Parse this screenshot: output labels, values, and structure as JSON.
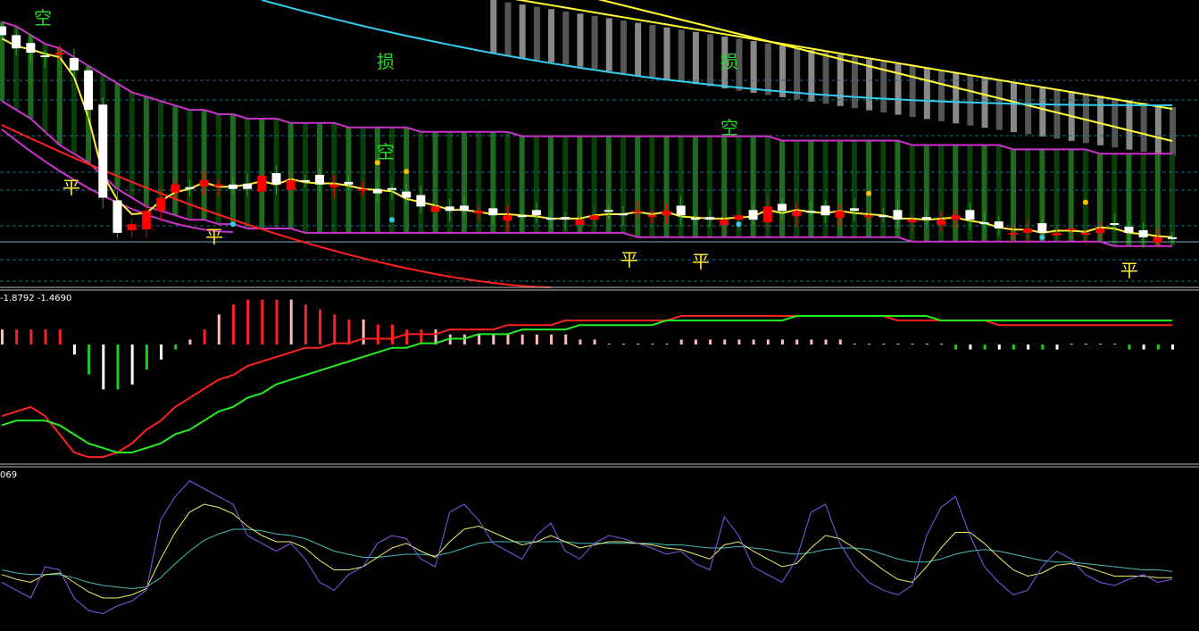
{
  "colors": {
    "background": "#000000",
    "bull": "#ff0000",
    "bear": "#ffffff",
    "band": "#cc33cc",
    "band_fill": "#1e6b1e",
    "upper_band": "#ffff33",
    "upper_fill": "#8a8a8a",
    "cyan_ma": "#33ccee",
    "red_ma": "#ff2020",
    "yellow_ma": "#ffee33",
    "white_seg": "#eeeeee",
    "green_label": "#22dd22",
    "yellow_label": "#ffee33",
    "macd_pos": "#ff2020",
    "macd_pos_light": "#ffbbbb",
    "macd_neg": "#22cc22",
    "macd_neg_light": "#ffffff",
    "diff_line": "#ff2020",
    "dea_line": "#22ee22",
    "osc_purple": "#8855ee",
    "osc_yellow": "#eeee66",
    "osc_cyan": "#44bbbb"
  },
  "panel2": {
    "values_label": "-1.8792  -1.4690"
  },
  "panel3": {
    "values_label": "069"
  },
  "signals": {
    "kong": "空",
    "ping": "平",
    "sun": "损"
  },
  "chart_data": [
    {
      "type": "candlestick",
      "panel": "main",
      "bars": 82,
      "closes": [
        97,
        94,
        93,
        92,
        93,
        89,
        80,
        60,
        52,
        54,
        57,
        60,
        63,
        62,
        64,
        63,
        62,
        62,
        65,
        63,
        64,
        64,
        63,
        63,
        63,
        62,
        61,
        62,
        60,
        58,
        58,
        57,
        57,
        57,
        56,
        56,
        56,
        56,
        55,
        55,
        55,
        56,
        57,
        56,
        57,
        56,
        57,
        56,
        55,
        55,
        55,
        56,
        55,
        58,
        57,
        57,
        57,
        56,
        57,
        57,
        56,
        56,
        55,
        55,
        55,
        55,
        56,
        55,
        54,
        53,
        52,
        53,
        52,
        52,
        53,
        52,
        53,
        54,
        52,
        51,
        51,
        51
      ],
      "series": [
        {
          "name": "upper band",
          "values": [
            100,
            99,
            97,
            95,
            94,
            92,
            90,
            88,
            86,
            84,
            83,
            82,
            81,
            80,
            80,
            79,
            79,
            78,
            78,
            78,
            77,
            77,
            77,
            77,
            76,
            76,
            76,
            76,
            76,
            75,
            75,
            75,
            75,
            75,
            75,
            75,
            74,
            74,
            74,
            74,
            74,
            74,
            74,
            74,
            74,
            74,
            74,
            74,
            74,
            74,
            74,
            74,
            74,
            74,
            73,
            73,
            73,
            73,
            73,
            73,
            73,
            73,
            73,
            72,
            72,
            72,
            72,
            72,
            72,
            72,
            71,
            71,
            71,
            71,
            71,
            71,
            70,
            70,
            70,
            70,
            70,
            70
          ]
        },
        {
          "name": "lower band",
          "values": [
            82,
            80,
            78,
            75,
            72,
            70,
            68,
            65,
            62,
            60,
            58,
            57,
            56,
            55,
            55,
            54,
            54,
            53,
            53,
            53,
            53,
            52,
            52,
            52,
            52,
            52,
            52,
            52,
            52,
            52,
            52,
            52,
            52,
            52,
            52,
            52,
            52,
            52,
            52,
            52,
            52,
            52,
            52,
            52,
            51,
            51,
            51,
            51,
            51,
            51,
            51,
            51,
            51,
            51,
            51,
            51,
            51,
            51,
            51,
            51,
            51,
            51,
            51,
            50,
            50,
            50,
            50,
            50,
            50,
            50,
            50,
            50,
            50,
            50,
            50,
            50,
            50,
            49,
            49,
            49,
            49,
            49
          ]
        }
      ]
    },
    {
      "type": "bar",
      "panel": "macd",
      "values": [
        3,
        3,
        3,
        3,
        3,
        -2,
        -6,
        -9,
        -9,
        -8,
        -5,
        -3,
        -1,
        1,
        3,
        6,
        8,
        9,
        9,
        9,
        9,
        8,
        7,
        6,
        5,
        5,
        4,
        4,
        3,
        3,
        3,
        2,
        2,
        2,
        2,
        2,
        2,
        2,
        2,
        2,
        1,
        1,
        0,
        0,
        0,
        0,
        0,
        1,
        1,
        1,
        1,
        1,
        1,
        1,
        1,
        1,
        1,
        1,
        1,
        0,
        0,
        0,
        0,
        0,
        0,
        0,
        -1,
        -1,
        -1,
        -1,
        -1,
        -1,
        -1,
        -1,
        0,
        0,
        0,
        0,
        -1,
        -1,
        -1,
        -1
      ],
      "series": [
        {
          "name": "DIFF",
          "values": [
            -12,
            -11,
            -10,
            -12,
            -16,
            -20,
            -21,
            -21,
            -20,
            -18,
            -15,
            -13,
            -10,
            -8,
            -6,
            -4,
            -3,
            -1,
            0,
            1,
            2,
            3,
            3,
            4,
            4,
            5,
            5,
            5,
            6,
            6,
            6,
            7,
            7,
            7,
            7,
            8,
            8,
            8,
            8,
            9,
            9,
            9,
            9,
            9,
            9,
            9,
            9,
            10,
            10,
            10,
            10,
            10,
            10,
            10,
            10,
            10,
            10,
            10,
            10,
            10,
            10,
            10,
            9,
            9,
            9,
            9,
            9,
            9,
            9,
            8,
            8,
            8,
            8,
            8,
            8,
            8,
            8,
            8,
            8,
            8,
            8,
            8
          ]
        },
        {
          "name": "DEA",
          "values": [
            -14,
            -13,
            -13,
            -13,
            -14,
            -16,
            -18,
            -19,
            -20,
            -20,
            -19,
            -18,
            -16,
            -15,
            -13,
            -11,
            -10,
            -8,
            -7,
            -5,
            -4,
            -3,
            -2,
            -1,
            0,
            1,
            2,
            3,
            3,
            4,
            4,
            5,
            5,
            6,
            6,
            6,
            7,
            7,
            7,
            7,
            8,
            8,
            8,
            8,
            8,
            8,
            9,
            9,
            9,
            9,
            9,
            9,
            9,
            9,
            9,
            10,
            10,
            10,
            10,
            10,
            10,
            10,
            10,
            10,
            10,
            9,
            9,
            9,
            9,
            9,
            9,
            9,
            9,
            9,
            9,
            9,
            9,
            9,
            9,
            9,
            9,
            9
          ]
        }
      ]
    },
    {
      "type": "line",
      "panel": "oscillator",
      "series": [
        {
          "name": "purple",
          "values": [
            30,
            25,
            20,
            40,
            38,
            20,
            12,
            10,
            15,
            18,
            25,
            70,
            85,
            95,
            90,
            85,
            80,
            60,
            55,
            50,
            55,
            45,
            30,
            25,
            35,
            40,
            55,
            60,
            58,
            45,
            40,
            75,
            80,
            70,
            55,
            50,
            45,
            60,
            68,
            50,
            45,
            55,
            60,
            58,
            55,
            52,
            48,
            50,
            42,
            38,
            72,
            60,
            40,
            35,
            30,
            45,
            75,
            80,
            55,
            40,
            30,
            25,
            22,
            28,
            60,
            78,
            85,
            60,
            40,
            30,
            22,
            25,
            40,
            50,
            45,
            35,
            30,
            28,
            32,
            35,
            30,
            32
          ]
        },
        {
          "name": "yellow",
          "values": [
            35,
            32,
            30,
            35,
            36,
            30,
            24,
            20,
            20,
            22,
            26,
            45,
            62,
            75,
            80,
            78,
            74,
            66,
            60,
            56,
            56,
            52,
            44,
            38,
            38,
            40,
            46,
            52,
            55,
            50,
            46,
            56,
            64,
            66,
            62,
            58,
            54,
            56,
            60,
            56,
            52,
            54,
            56,
            56,
            55,
            54,
            52,
            51,
            48,
            45,
            54,
            56,
            50,
            45,
            40,
            42,
            52,
            60,
            58,
            52,
            45,
            38,
            32,
            30,
            40,
            52,
            62,
            62,
            55,
            46,
            38,
            34,
            36,
            41,
            42,
            40,
            37,
            34,
            34,
            34,
            33,
            33
          ]
        },
        {
          "name": "cyan",
          "values": [
            38,
            36,
            35,
            35,
            35,
            33,
            30,
            28,
            27,
            26,
            27,
            33,
            42,
            50,
            57,
            61,
            64,
            64,
            63,
            61,
            60,
            58,
            54,
            50,
            48,
            46,
            46,
            47,
            48,
            48,
            47,
            49,
            52,
            55,
            56,
            56,
            56,
            56,
            56,
            56,
            55,
            55,
            55,
            55,
            55,
            55,
            54,
            54,
            53,
            52,
            52,
            53,
            52,
            51,
            49,
            48,
            49,
            51,
            52,
            52,
            51,
            48,
            45,
            43,
            43,
            45,
            48,
            50,
            51,
            50,
            48,
            46,
            44,
            43,
            43,
            42,
            41,
            40,
            39,
            38,
            38,
            37
          ]
        }
      ]
    }
  ]
}
